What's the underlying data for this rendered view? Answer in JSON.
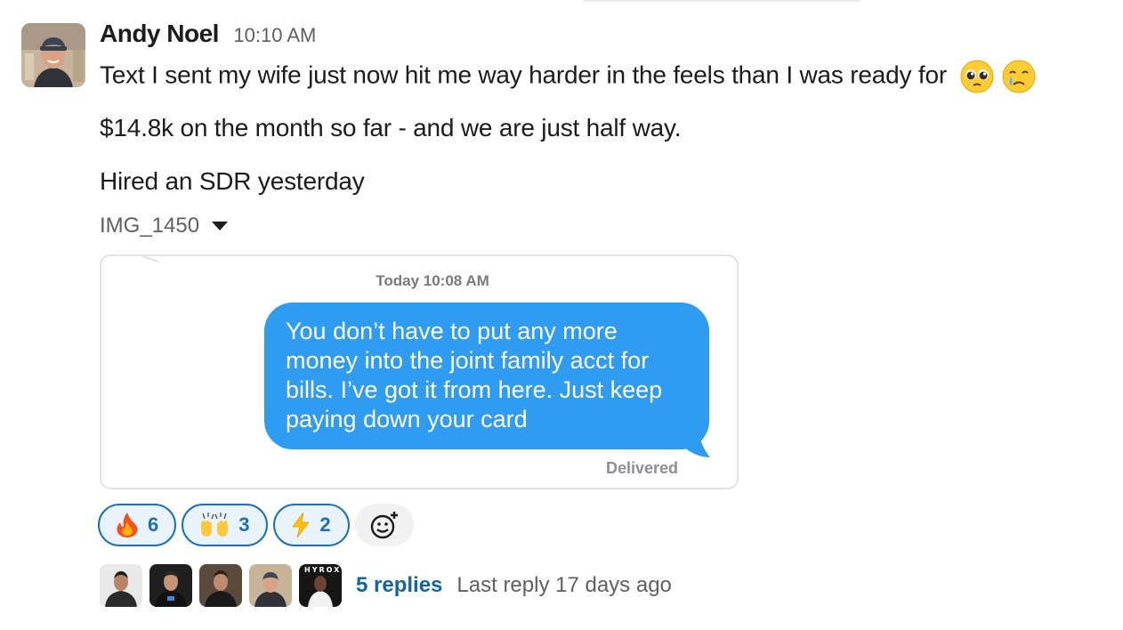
{
  "message": {
    "author": "Andy Noel",
    "time": "10:10 AM",
    "lines": [
      "Text I sent my wife just now hit me way harder in the feels than I was ready for",
      "$14.8k on the month so far - and we are just half way.",
      "Hired an SDR yesterday"
    ],
    "line1_emojis": [
      "pleading-face-icon",
      "crying-face-icon"
    ]
  },
  "attachment": {
    "file_name": "IMG_1450",
    "image": {
      "date_label": "Today 10:08 AM",
      "bubble_text": "You don’t have to put any more money into the joint family acct for bills. I’ve got it from here. Just keep paying down your card",
      "status": "Delivered",
      "bubble_color": "#2f9bf1"
    }
  },
  "reactions": [
    {
      "emoji": "🔥",
      "icon": "fire-icon",
      "count": "6"
    },
    {
      "emoji": "🙌",
      "icon": "raised-hands-icon",
      "count": "3"
    },
    {
      "emoji": "⚡",
      "icon": "lightning-icon",
      "count": "2"
    }
  ],
  "thread": {
    "replies_label": "5 replies",
    "last_reply": "Last reply 17 days ago",
    "avatar_badge": "HYROX"
  },
  "colors": {
    "link": "#1264a3",
    "reaction_border": "#1d70b8",
    "reaction_bg": "#e8f3fc"
  }
}
